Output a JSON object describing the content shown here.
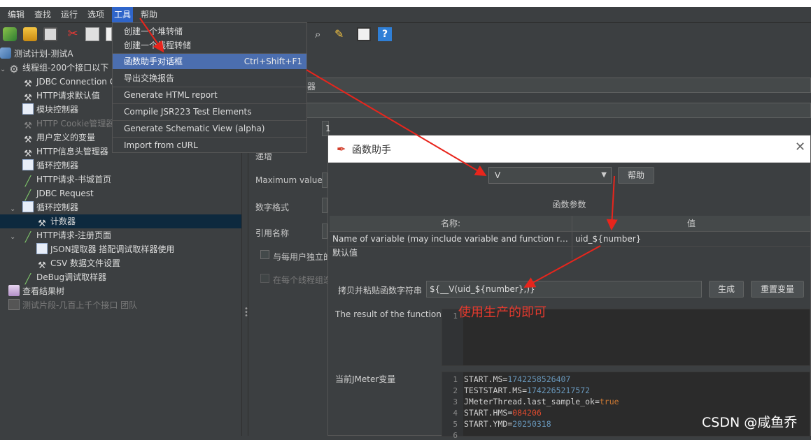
{
  "menubar": {
    "items": [
      "编辑",
      "查找",
      "运行",
      "选项",
      "工具",
      "帮助"
    ]
  },
  "tools_menu": {
    "items": [
      {
        "label": "创建一个堆转储",
        "accel": ""
      },
      {
        "label": "创建一个线程转储",
        "accel": ""
      },
      {
        "label": "函数助手对话框",
        "accel": "Ctrl+Shift+F1"
      },
      {
        "label": "导出交换报告",
        "accel": ""
      },
      {
        "label": "Generate HTML report",
        "accel": ""
      },
      {
        "label": "Compile JSR223 Test Elements",
        "accel": ""
      },
      {
        "label": "Generate Schematic View (alpha)",
        "accel": ""
      },
      {
        "label": "Import from cURL",
        "accel": ""
      }
    ]
  },
  "tree": {
    "nodes": [
      {
        "label": "测试计划-测试A",
        "icon": "test-plan-icon"
      },
      {
        "label": "线程组-200个接口以下",
        "icon": "gear-icon"
      },
      {
        "label": "JDBC Connection Co",
        "icon": "wrench-icon"
      },
      {
        "label": "HTTP请求默认值",
        "icon": "wrench-icon"
      },
      {
        "label": "模块控制器",
        "icon": "controller-icon"
      },
      {
        "label": "HTTP Cookie管理器",
        "icon": "wrench-icon"
      },
      {
        "label": "用户定义的变量",
        "icon": "wrench-icon"
      },
      {
        "label": "HTTP信息头管理器",
        "icon": "wrench-icon"
      },
      {
        "label": "循环控制器",
        "icon": "controller-icon"
      },
      {
        "label": "HTTP请求-书城首页",
        "icon": "sampler-icon"
      },
      {
        "label": "JDBC Request",
        "icon": "sampler-icon"
      },
      {
        "label": "循环控制器",
        "icon": "controller-icon"
      },
      {
        "label": "计数器",
        "icon": "wrench-icon"
      },
      {
        "label": "HTTP请求-注册页面",
        "icon": "sampler-icon"
      },
      {
        "label": "JSON提取器 搭配调试取样器使用",
        "icon": "extractor-icon"
      },
      {
        "label": "CSV 数据文件设置",
        "icon": "wrench-icon"
      },
      {
        "label": "DeBug调试取样器",
        "icon": "sampler-icon"
      },
      {
        "label": "查看结果树",
        "icon": "listener-icon"
      },
      {
        "label": "测试片段-几百上千个接口 团队",
        "icon": "fragment-icon"
      }
    ]
  },
  "counter_panel": {
    "title_suffix": "器",
    "start_value": "1",
    "increment_label": "递增",
    "max_label": "Maximum value",
    "format_label": "数字格式",
    "refname_label": "引用名称",
    "per_user_label": "与每用户独立的",
    "per_iteration_label": "在每个线程组迭"
  },
  "function_dialog": {
    "title": "函数助手",
    "function_selected": "V",
    "help_button": "帮助",
    "params_title": "函数参数",
    "col_name": "名称:",
    "col_value": "值",
    "rows": [
      {
        "name": "Name of variable (may include variable and function referenc...",
        "value": "uid_${number}"
      },
      {
        "name": "默认值",
        "value": ""
      }
    ],
    "copy_label": "拷贝并粘贴函数字符串",
    "function_string": "${__V(uid_${number},)}",
    "generate_button": "生成",
    "reset_button": "重置变量",
    "result_label": "The result of the function is",
    "jmeter_vars_label": "当前JMeter变量",
    "vars": [
      {
        "key": "START.MS",
        "value": "1742258526407",
        "kind": "num"
      },
      {
        "key": "TESTSTART.MS",
        "value": "1742265217572",
        "kind": "num"
      },
      {
        "key": "JMeterThread.last_sample_ok",
        "value": "true",
        "kind": "kw"
      },
      {
        "key": "START.HMS",
        "value": "084206",
        "kind": "red"
      },
      {
        "key": "START.YMD",
        "value": "20250318",
        "kind": "num"
      }
    ]
  },
  "annotation": "使用生产的即可",
  "watermark": "CSDN @咸鱼乔",
  "colors": {
    "menu_highlight": "#4b6eaf",
    "annotation_red": "#e53a2e",
    "arrow_red": "#e8251c"
  }
}
